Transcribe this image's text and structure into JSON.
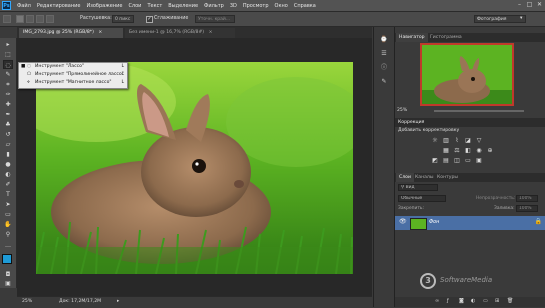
{
  "app": {
    "logo": "Ps"
  },
  "menu": [
    "Файл",
    "Редактирование",
    "Изображение",
    "Слои",
    "Текст",
    "Выделение",
    "Фильтр",
    "3D",
    "Просмотр",
    "Окно",
    "Справка"
  ],
  "window_controls": {
    "minimize": "–",
    "maximize": "□",
    "close": "✕"
  },
  "options": {
    "feather_label": "Растушевка:",
    "feather_value": "0 пикс",
    "antialias_label": "Сглаживание",
    "refine_label": "Уточн. край...",
    "workspace": "Фотография"
  },
  "tabs": [
    {
      "label": "IMG_2793.jpg @ 25% (RGB/8*)",
      "close": "×"
    },
    {
      "label": "Без имени-1 @ 16,7% (RGB/8#)",
      "close": "×"
    }
  ],
  "tool_popup": {
    "items": [
      {
        "label": "Инструмент \"Лассо\"",
        "key": "L"
      },
      {
        "label": "Инструмент \"Прямолинейное лассо\"",
        "key": "L"
      },
      {
        "label": "Инструмент \"Магнитное лассо\"",
        "key": "L"
      }
    ]
  },
  "status": {
    "zoom": "25%",
    "doc": "Док: 17,2M/17,2M"
  },
  "navigator": {
    "tabs": [
      "Навигатор",
      "Гистограмма"
    ],
    "zoom": "25%"
  },
  "adjustments": {
    "title": "Коррекция",
    "subtitle": "Добавить корректировку"
  },
  "layers": {
    "tabs": [
      "Слои",
      "Каналы",
      "Контуры"
    ],
    "kind": "Вид",
    "blend": "Обычные",
    "opacity_label": "Непрозрачность:",
    "opacity_value": "100%",
    "lock_label": "Закрепить:",
    "fill_label": "Заливка:",
    "fill_value": "100%",
    "layer_name": "Фон"
  },
  "watermark": {
    "text": "SoftwareMedia"
  },
  "colors": {
    "accent_blue": "#4a6fa5",
    "fg": "#1e9bd7",
    "bg": "#ffffff"
  }
}
